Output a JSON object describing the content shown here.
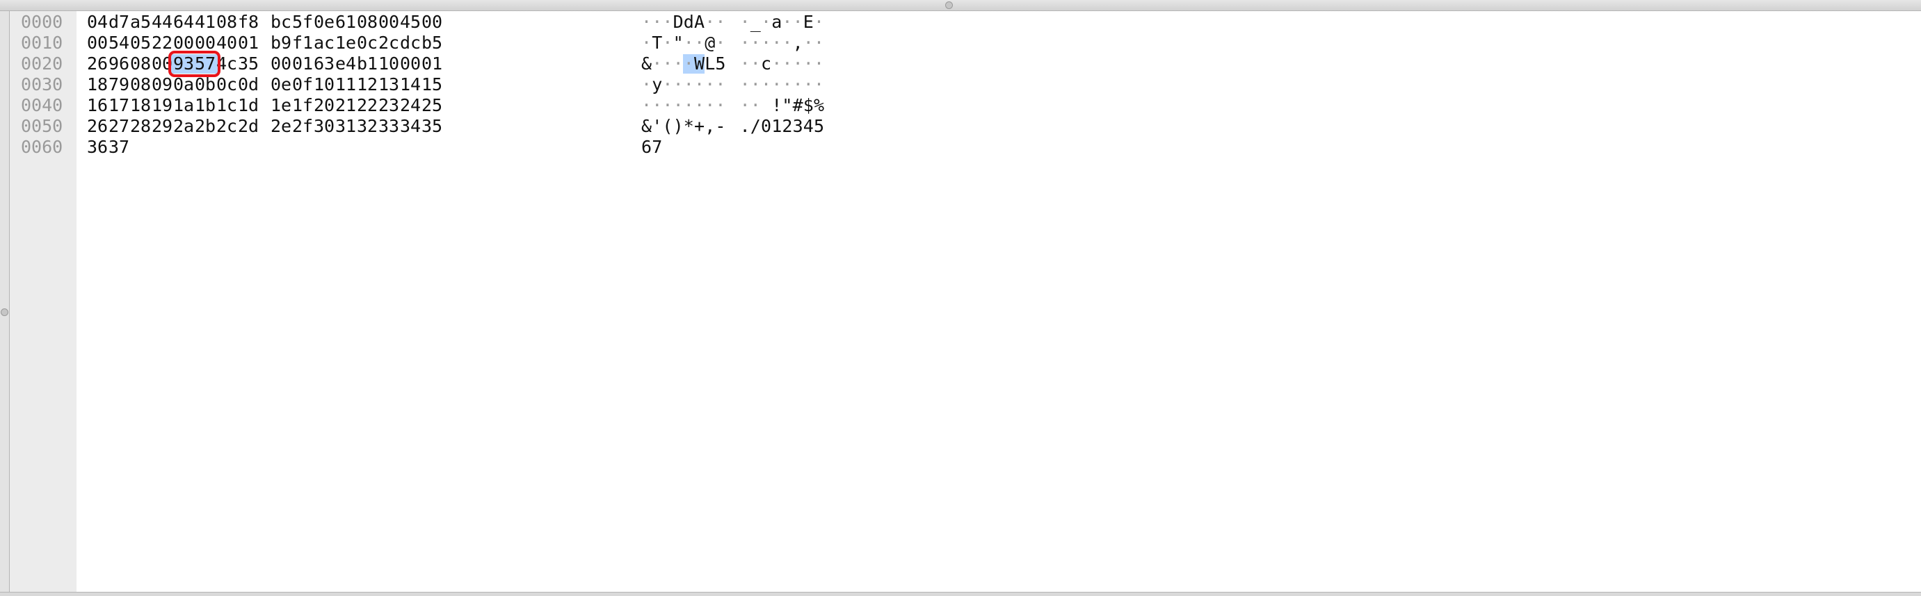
{
  "hex_view": {
    "rows": [
      {
        "offset": "0000",
        "bytes": [
          "04",
          "d7",
          "a5",
          "44",
          "64",
          "41",
          "08",
          "f8",
          "bc",
          "5f",
          "0e",
          "61",
          "08",
          "00",
          "45",
          "00"
        ],
        "ascii": [
          "·",
          "·",
          "·",
          "D",
          "d",
          "A",
          "·",
          "·",
          "·",
          "_",
          "·",
          "a",
          "·",
          "·",
          "E",
          "·"
        ]
      },
      {
        "offset": "0010",
        "bytes": [
          "00",
          "54",
          "05",
          "22",
          "00",
          "00",
          "40",
          "01",
          "b9",
          "f1",
          "ac",
          "1e",
          "0c",
          "2c",
          "dc",
          "b5"
        ],
        "ascii": [
          "·",
          "T",
          "·",
          "\"",
          "·",
          "·",
          "@",
          "·",
          "·",
          "·",
          "·",
          "·",
          "·",
          ",",
          "·",
          "·"
        ]
      },
      {
        "offset": "0020",
        "bytes": [
          "26",
          "96",
          "08",
          "00",
          "93",
          "57",
          "4c",
          "35",
          "00",
          "01",
          "63",
          "e4",
          "b1",
          "10",
          "00",
          "01"
        ],
        "ascii": [
          "&",
          "·",
          "·",
          "·",
          "·",
          "W",
          "L",
          "5",
          "·",
          "·",
          "c",
          "·",
          "·",
          "·",
          "·",
          "·"
        ]
      },
      {
        "offset": "0030",
        "bytes": [
          "18",
          "79",
          "08",
          "09",
          "0a",
          "0b",
          "0c",
          "0d",
          "0e",
          "0f",
          "10",
          "11",
          "12",
          "13",
          "14",
          "15"
        ],
        "ascii": [
          "·",
          "y",
          "·",
          "·",
          "·",
          "·",
          "·",
          "·",
          "·",
          "·",
          "·",
          "·",
          "·",
          "·",
          "·",
          "·"
        ]
      },
      {
        "offset": "0040",
        "bytes": [
          "16",
          "17",
          "18",
          "19",
          "1a",
          "1b",
          "1c",
          "1d",
          "1e",
          "1f",
          "20",
          "21",
          "22",
          "23",
          "24",
          "25"
        ],
        "ascii": [
          "·",
          "·",
          "·",
          "·",
          "·",
          "·",
          "·",
          "·",
          "·",
          "·",
          " ",
          "!",
          "\"",
          "#",
          "$",
          "%"
        ]
      },
      {
        "offset": "0050",
        "bytes": [
          "26",
          "27",
          "28",
          "29",
          "2a",
          "2b",
          "2c",
          "2d",
          "2e",
          "2f",
          "30",
          "31",
          "32",
          "33",
          "34",
          "35"
        ],
        "ascii": [
          "&",
          "'",
          "(",
          ")",
          "*",
          "+",
          ",",
          "-",
          ".",
          "/",
          "0",
          "1",
          "2",
          "3",
          "4",
          "5"
        ]
      },
      {
        "offset": "0060",
        "bytes": [
          "36",
          "37"
        ],
        "ascii": [
          "6",
          "7"
        ]
      }
    ],
    "selection": {
      "row": 2,
      "start": 4,
      "end": 5
    }
  }
}
